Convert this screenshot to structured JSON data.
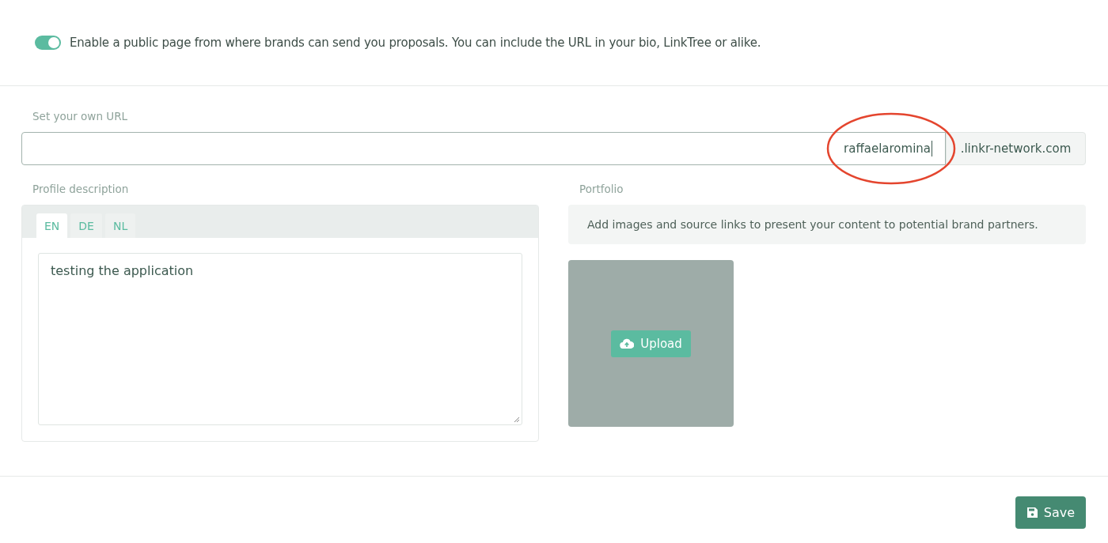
{
  "public_page": {
    "on": true,
    "text": "Enable a public page from where brands can send you proposals. You can include the URL in your bio, LinkTree or alike."
  },
  "url": {
    "label": "Set your own URL",
    "value": "raffaelaromina",
    "suffix": ".linkr-network.com"
  },
  "description": {
    "label": "Profile description",
    "tabs": [
      {
        "label": "EN",
        "selected": true
      },
      {
        "label": "DE",
        "selected": false
      },
      {
        "label": "NL",
        "selected": false
      }
    ],
    "value": "testing the application"
  },
  "portfolio": {
    "label": "Portfolio",
    "info": "Add images and source links to present your content to potential brand partners.",
    "upload_button": "Upload"
  },
  "save_button": "Save"
}
